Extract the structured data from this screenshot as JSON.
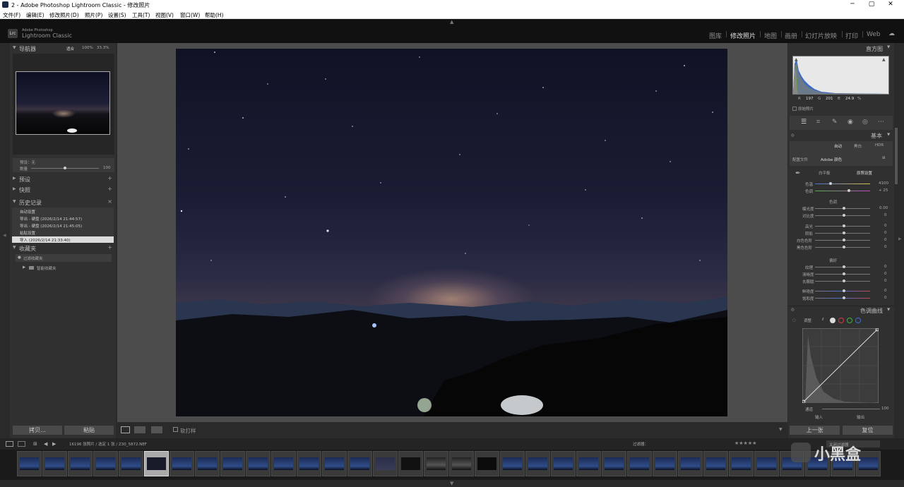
{
  "window": {
    "title": "2 - Adobe Photoshop Lightroom Classic - 修改照片",
    "minimize": "─",
    "maximize": "▢",
    "close": "✕"
  },
  "menu": [
    "文件(F)",
    "编辑(E)",
    "修改照片(D)",
    "照片(P)",
    "设置(S)",
    "工具(T)",
    "视图(V)",
    "窗口(W)",
    "帮助(H)"
  ],
  "logo": {
    "badge": "Lrc",
    "line1": "Adobe Photoshop",
    "line2": "Lightroom Classic"
  },
  "modules": [
    "图库",
    "修改照片",
    "地图",
    "画册",
    "幻灯片放映",
    "打印",
    "Web"
  ],
  "active_module": "修改照片",
  "left": {
    "navigator": {
      "title": "导航器",
      "zooms": [
        "适合",
        "100%",
        "33.3%"
      ]
    },
    "nav_info": {
      "preset_label": "预设：无",
      "amount_label": "数量",
      "amount_value": "100"
    },
    "presets": "预设",
    "snapshots": "快照",
    "history": {
      "title": "历史记录",
      "items": [
        "自动设置",
        "导出 - 硬盘 (2026/2/14 21:44:57)",
        "导出 - 硬盘 (2026/2/14 21:45:05)",
        "粘贴设置",
        "导入 (2026/2/14 21:33:40)"
      ]
    },
    "collections": {
      "title": "收藏夹",
      "items": [
        "过滤收藏夹",
        "智能收藏夹"
      ]
    },
    "copy_btn": "拷贝...",
    "paste_btn": "粘贴"
  },
  "toolbar": {
    "soft_proof": "软打样"
  },
  "right": {
    "histogram": {
      "title": "直方图",
      "r_label": "R",
      "r": "197",
      "g_label": "G",
      "g": "201",
      "b_label": "B",
      "b": "24.9",
      "pct": "%",
      "original": "原始照片"
    },
    "basic": {
      "title": "基本",
      "auto": "自动",
      "bw": "黑白",
      "hdr": "HDR",
      "profile_label": "配置文件",
      "profile_value": "Adobe 颜色",
      "wb_label": "白平衡",
      "wb_value": "原照设置",
      "temp_label": "色温",
      "temp_value": "4100",
      "tint_label": "色调",
      "tint_value": "+ 25",
      "tone_title": "色调",
      "exposure_label": "曝光度",
      "exposure_value": "0.00",
      "contrast_label": "对比度",
      "contrast_value": "0",
      "highlights_label": "高光",
      "highlights_value": "0",
      "shadows_label": "阴影",
      "shadows_value": "0",
      "whites_label": "白色色阶",
      "whites_value": "0",
      "blacks_label": "黑色色阶",
      "blacks_value": "0",
      "presence_title": "偏好",
      "texture_label": "纹理",
      "texture_value": "0",
      "clarity_label": "清晰度",
      "clarity_value": "0",
      "dehaze_label": "去朦胧",
      "dehaze_value": "0",
      "vibrance_label": "鲜艳度",
      "vibrance_value": "0",
      "saturation_label": "饱和度",
      "saturation_value": "0"
    },
    "tonecurve": {
      "title": "色调曲线",
      "adjust": "调整",
      "channel": "通道",
      "input": "输入",
      "output": "输出",
      "max": "100"
    },
    "prev_btn": "上一张",
    "reset_btn": "复位"
  },
  "filmstrip": {
    "counts": "16196 张照片 / 选定 1 张 / Z30_5872.NEF",
    "filter_label": "过滤器：",
    "filter_value": "关闭过滤器"
  },
  "watermark": "小黑盒",
  "colors": {
    "accent": "#6f8fd0",
    "active_history": "#dcdcdc",
    "panel": "#303030"
  }
}
